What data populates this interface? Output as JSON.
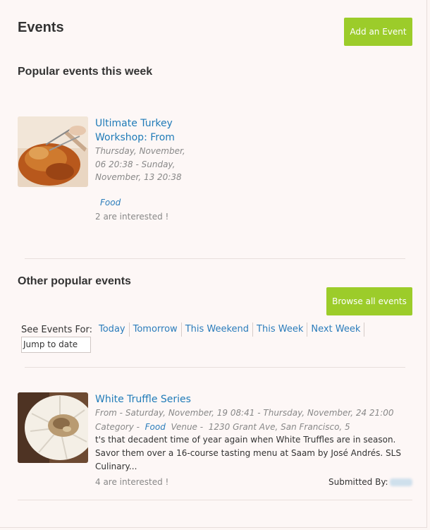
{
  "header": {
    "title": "Events",
    "add_event_label": "Add an Event"
  },
  "popular": {
    "heading": "Popular events this week",
    "event": {
      "title": "Ultimate Turkey Workshop: From",
      "date": "Thursday, November, 06 20:38 - Sunday, November, 13 20:38",
      "category": "Food",
      "interested": "2 are interested !",
      "image_icon": "roast-turkey-photo"
    }
  },
  "other": {
    "heading": "Other popular events",
    "browse_label": "Browse all events",
    "see_events_label": "See Events For:",
    "filters": [
      "Today",
      "Tomorrow",
      "This Weekend",
      "This Week",
      "Next Week"
    ],
    "jump_placeholder": "Jump to date"
  },
  "featured": {
    "title": "White Truffle Series",
    "from_prefix": "From - ",
    "dates": "Saturday, November, 19 08:41 - Thursday, November, 24 21:00",
    "category_prefix": "Category - ",
    "category": "Food",
    "venue_prefix": "Venue - ",
    "venue": "1230 Grant Ave, San Francisco, 5",
    "description": "t's that decadent time of year again when White Truffles are in season. Savor them over a 16-course tasting menu at Saam by José Andrés. SLS Culinary...",
    "interested": "4 are interested !",
    "submitted_label": "Submitted By:",
    "image_icon": "truffle-dish-photo"
  },
  "colors": {
    "accent_green": "#9ccc2a",
    "link_blue": "#1f7bb8",
    "background": "#fdf7f6"
  }
}
